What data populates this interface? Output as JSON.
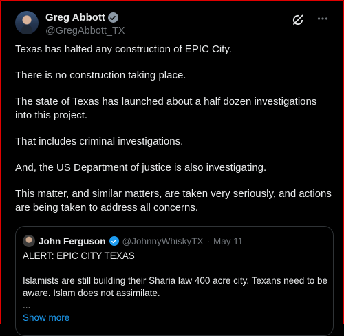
{
  "tweet": {
    "display_name": "Greg Abbott",
    "handle": "@GregAbbott_TX",
    "icons": {
      "verified": "verified-badge-icon",
      "grok": "grok-icon",
      "more": "more-options-icon"
    },
    "paragraphs": [
      "Texas has halted any construction of EPIC City.",
      "There is no construction taking place.",
      "The state of Texas has launched about a half dozen investigations into this project.",
      "That includes criminal investigations.",
      "And, the US Department of justice is also investigating.",
      "This matter, and similar matters, are taken very seriously, and actions are being taken to address all concerns."
    ]
  },
  "quote": {
    "display_name": "John Ferguson",
    "handle": "@JohnnyWhiskyTX",
    "separator": "·",
    "date": "May 11",
    "lines": [
      "ALERT: EPIC CITY TEXAS",
      "Islamists are still building their Sharia law 400 acre city. Texans need to be aware. Islam does not assimilate.",
      "..."
    ],
    "show_more": "Show more"
  },
  "colors": {
    "background": "#000000",
    "text": "#e7e9ea",
    "muted": "#71767b",
    "link": "#1d9bf0",
    "gov_badge": "#8b98a5",
    "border": "#2f3336"
  }
}
